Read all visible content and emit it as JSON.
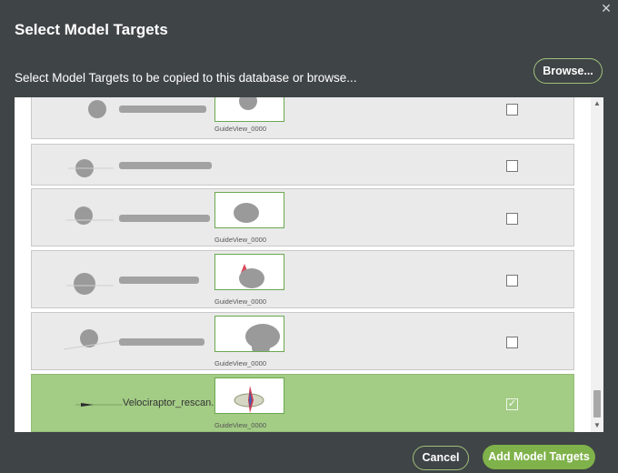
{
  "dialog": {
    "title": "Select Model Targets",
    "subtitle": "Select Model Targets to be copied to this database or browse...",
    "browse_label": "Browse...",
    "close_icon": "close-icon",
    "cancel_label": "Cancel",
    "add_label": "Add Model Targets"
  },
  "colors": {
    "background": "#3f4446",
    "accent": "#7fb24a",
    "selected_row": "#a3cc85"
  },
  "list": {
    "rows": [
      {
        "name": "",
        "guide_caption": "GuideView_0000",
        "checked": false,
        "has_guide": true,
        "redacted_name": true
      },
      {
        "name": "",
        "guide_caption": "",
        "checked": false,
        "has_guide": false,
        "redacted_name": true
      },
      {
        "name": "",
        "guide_caption": "GuideView_0000",
        "checked": false,
        "has_guide": true,
        "redacted_name": true
      },
      {
        "name": "",
        "guide_caption": "GuideView_0000",
        "checked": false,
        "has_guide": true,
        "redacted_name": true
      },
      {
        "name": "",
        "guide_caption": "GuideView_0000",
        "checked": false,
        "has_guide": true,
        "redacted_name": true
      },
      {
        "name": "Velociraptor_rescan...",
        "guide_caption": "GuideView_0000",
        "checked": true,
        "has_guide": true,
        "redacted_name": false
      }
    ]
  },
  "checkmark": "✓"
}
